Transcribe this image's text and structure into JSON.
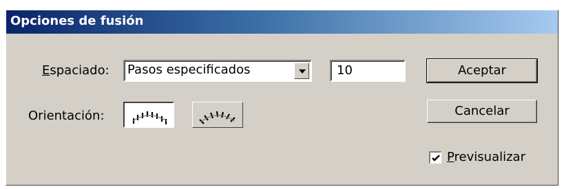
{
  "dialog": {
    "title": "Opciones de fusión"
  },
  "spacing": {
    "label_prefix": "E",
    "label_rest": "spaciado:",
    "selected": "Pasos especificados",
    "steps_value": "10"
  },
  "orientation": {
    "label": "Orientación:",
    "options": [
      {
        "name": "align-to-page-icon",
        "active": true
      },
      {
        "name": "align-to-path-icon",
        "active": false
      }
    ]
  },
  "buttons": {
    "ok": "Aceptar",
    "cancel": "Cancelar"
  },
  "preview": {
    "label_prefix": "P",
    "label_rest": "revisualizar",
    "checked": true
  }
}
